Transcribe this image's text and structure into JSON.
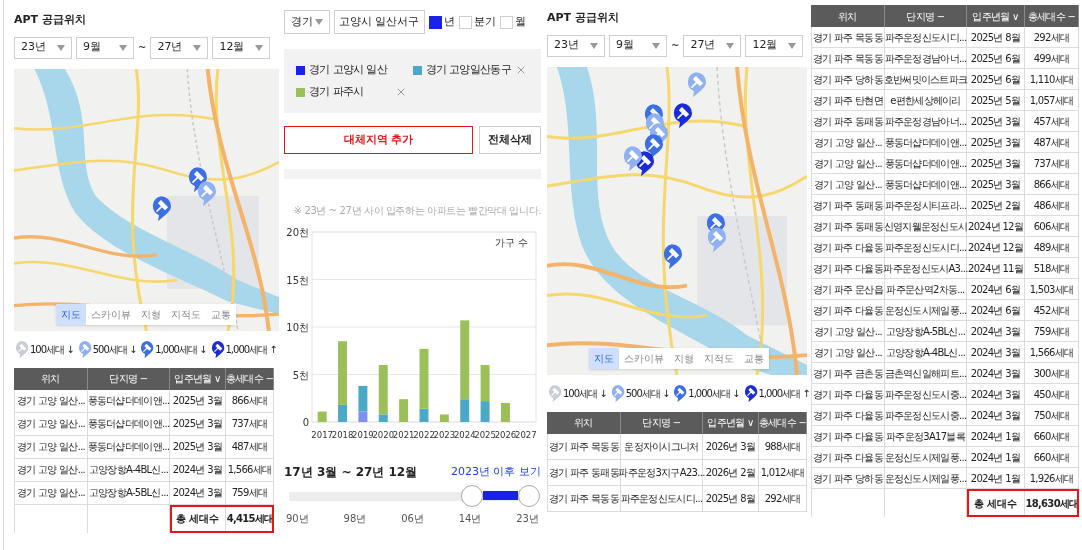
{
  "supply_left": {
    "title": "APT 공급위치",
    "period": {
      "from_year": "23년",
      "from_month": "9월",
      "separator": "~",
      "to_year": "27년",
      "to_month": "12월"
    },
    "map": {
      "kind": "picture",
      "markers": [
        {
          "color": "#3c6fe6"
        },
        {
          "color": "#3c6fe6"
        },
        {
          "color": "#8fb0f2"
        }
      ],
      "map_types": [
        {
          "label": "지도",
          "selected": true
        },
        {
          "label": "스카이뷰",
          "selected": false
        },
        {
          "label": "지형",
          "selected": false
        },
        {
          "label": "지적도",
          "selected": false
        },
        {
          "label": "교통",
          "selected": false
        }
      ]
    },
    "legend": [
      {
        "label": "100세대 ↓",
        "color": "#c8ccd4"
      },
      {
        "label": "500세대 ↓",
        "color": "#8fb0f2"
      },
      {
        "label": "1,000세대 ↓",
        "color": "#3c6fe6"
      },
      {
        "label": "1,000세대 ↑",
        "color": "#1a2bd8"
      }
    ],
    "table": {
      "columns": [
        "위치",
        "단지명 −",
        "입주년월 ∨",
        "총세대수 −"
      ],
      "rows": [
        [
          "경기 고양 일산...",
          "풍동더샵더데이앤...",
          "2025년 3월",
          "866세대"
        ],
        [
          "경기 고양 일산...",
          "풍동더샵더데이앤...",
          "2025년 3월",
          "737세대"
        ],
        [
          "경기 고양 일산...",
          "풍동더샵더데이앤...",
          "2025년 3월",
          "487세대"
        ],
        [
          "경기 고양 일산...",
          "고양장항A-4BL신...",
          "2024년 3월",
          "1,566세대"
        ],
        [
          "경기 고양 일산...",
          "고양장항A-5BL신...",
          "2024년 3월",
          "759세대"
        ]
      ],
      "total": {
        "label": "총 세대수",
        "value": "4,415세대"
      }
    }
  },
  "filter": {
    "province": "경기",
    "district": "고양시 일산서구",
    "periods": [
      {
        "label": "년",
        "checked": true
      },
      {
        "label": "분기",
        "checked": false
      },
      {
        "label": "월",
        "checked": false
      }
    ],
    "regions": [
      {
        "name": "경기 고양시 일산",
        "color": "#1a22e8",
        "removable": false
      },
      {
        "name": "경기 고양일산동구",
        "color": "#4ba9c8",
        "removable": true
      },
      {
        "name": "경기 파주시",
        "color": "#9bc05a",
        "removable": true
      }
    ],
    "buttons": [
      {
        "label": "대체지역 추가",
        "kind": "primary"
      },
      {
        "label": "전체삭제",
        "kind": "plain"
      }
    ],
    "note": "※ 23년 ~ 27년 사이 입주하는 아파트는 빨간막대 입니다.",
    "chart_data": {
      "type": "bar",
      "stacked": true,
      "categories": [
        "2017",
        "2018",
        "2019",
        "2020",
        "2021",
        "2022",
        "2023",
        "2024",
        "2025",
        "2026",
        "2027"
      ],
      "series": [
        {
          "color": "#8090f0",
          "values": [
            null,
            null,
            1.1,
            null,
            null,
            null,
            null,
            null,
            null,
            null,
            null
          ]
        },
        {
          "color": "#4ba9c8",
          "values": [
            null,
            1.8,
            2.7,
            0.8,
            null,
            1.4,
            null,
            2.4,
            2.2,
            null,
            null
          ]
        },
        {
          "color": "#9bc05a",
          "values": [
            1.1,
            6.7,
            null,
            5.2,
            2.4,
            6.3,
            0.8,
            8.3,
            3.8,
            2.0,
            null
          ]
        }
      ],
      "grid": true,
      "ylim": [
        0,
        20
      ],
      "yticks": [
        {
          "value": 0,
          "label": "0"
        },
        {
          "value": 5,
          "label": "5천"
        },
        {
          "value": 10,
          "label": "10천"
        },
        {
          "value": 15,
          "label": "15천"
        },
        {
          "value": 20,
          "label": "20천"
        }
      ],
      "annotations": [
        "가구 수"
      ]
    },
    "range_label": "17년 3월 ~ 27년 12월",
    "range_link": "2023년 이후 보기",
    "range": {
      "thumbs": [
        {
          "level": 0.74
        },
        {
          "level": 0.97
        }
      ],
      "ticks": [
        "90년",
        "98년",
        "06년",
        "14년",
        "23년"
      ]
    }
  },
  "supply_right": {
    "title": "APT 공급위치",
    "period": {
      "from_year": "23년",
      "from_month": "9월",
      "separator": "~",
      "to_year": "27년",
      "to_month": "12월"
    },
    "map": {
      "kind": "picture",
      "markers": [
        {
          "color": "#8fb0f2"
        },
        {
          "color": "#1a2bd8"
        },
        {
          "color": "#3c6fe6"
        },
        {
          "color": "#8fb0f2"
        },
        {
          "color": "#8fb0f2"
        },
        {
          "color": "#3c6fe6"
        },
        {
          "color": "#1a2bd8"
        },
        {
          "color": "#8fb0f2"
        },
        {
          "color": "#3c6fe6"
        },
        {
          "color": "#8fb0f2"
        },
        {
          "color": "#3c6fe6"
        }
      ],
      "map_types": [
        {
          "label": "지도",
          "selected": true
        },
        {
          "label": "스카이뷰",
          "selected": false
        },
        {
          "label": "지형",
          "selected": false
        },
        {
          "label": "지적도",
          "selected": false
        },
        {
          "label": "교통",
          "selected": false
        }
      ]
    },
    "legend": [
      {
        "label": "100세대 ↓",
        "color": "#c8ccd4"
      },
      {
        "label": "500세대 ↓",
        "color": "#8fb0f2"
      },
      {
        "label": "1,000세대 ↓",
        "color": "#3c6fe6"
      },
      {
        "label": "1,000세대 ↑",
        "color": "#1a2bd8"
      }
    ],
    "table": {
      "columns": [
        "위치",
        "단지명 −",
        "입주년월 ∨",
        "총세대수 −"
      ],
      "rows": [
        [
          "경기 파주 목동동",
          "운정자이시그니처",
          "2026년 3월",
          "988세대"
        ],
        [
          "경기 파주 동패동",
          "파주운정3지구A23...",
          "2026년 2월",
          "1,012세대"
        ],
        [
          "경기 파주 목동동",
          "파주운정신도시디...",
          "2025년 8월",
          "292세대"
        ]
      ]
    }
  },
  "list": {
    "columns": [
      "위치",
      "단지명 −",
      "입주년월 ∨",
      "총세대수 −"
    ],
    "rows": [
      [
        "경기 파주 목동동",
        "파주운정신도시디...",
        "2025년 8월",
        "292세대"
      ],
      [
        "경기 파주 목동동",
        "파주운정경남아너...",
        "2025년 6월",
        "499세대"
      ],
      [
        "경기 파주 당하동",
        "호반써밋이스트파크",
        "2025년 6월",
        "1,110세대"
      ],
      [
        "경기 파주 탄현면",
        "e편한세상헤이리",
        "2025년 5월",
        "1,057세대"
      ],
      [
        "경기 파주 동패동",
        "파주운정경남아너...",
        "2025년 3월",
        "457세대"
      ],
      [
        "경기 고양 일산...",
        "풍동더샵더데이앤...",
        "2025년 3월",
        "487세대"
      ],
      [
        "경기 고양 일산...",
        "풍동더샵더데이앤...",
        "2025년 3월",
        "737세대"
      ],
      [
        "경기 고양 일산...",
        "풍동더샵더데이앤...",
        "2025년 3월",
        "866세대"
      ],
      [
        "경기 파주 동패동",
        "파주운정시티프라...",
        "2025년 2월",
        "486세대"
      ],
      [
        "경기 파주 동패동",
        "신영지웰운정신도시",
        "2024년 12월",
        "606세대"
      ],
      [
        "경기 파주 다율동",
        "파주운정신도시디...",
        "2024년 12월",
        "489세대"
      ],
      [
        "경기 파주 다율동",
        "파주운정신도시A3...",
        "2024년 11월",
        "518세대"
      ],
      [
        "경기 파주 문산읍",
        "파주문산역2차동...",
        "2024년 6월",
        "1,503세대"
      ],
      [
        "경기 파주 다율동",
        "운정신도시제일풍...",
        "2024년 6월",
        "452세대"
      ],
      [
        "경기 고양 일산...",
        "고양장항A-5BL신...",
        "2024년 3월",
        "759세대"
      ],
      [
        "경기 고양 일산...",
        "고양장항A-4BL신...",
        "2024년 3월",
        "1,566세대"
      ],
      [
        "경기 파주 금촌동",
        "금촌역신일해피트...",
        "2024년 3월",
        "300세대"
      ],
      [
        "경기 파주 다율동",
        "파주운정신도시중...",
        "2024년 3월",
        "450세대"
      ],
      [
        "경기 파주 다율동",
        "파주운정신도시중...",
        "2024년 3월",
        "750세대"
      ],
      [
        "경기 파주 다율동",
        "파주운정3A17블록",
        "2024년 1월",
        "660세대"
      ],
      [
        "경기 파주 다율동",
        "운정신도시제일풍...",
        "2024년 1월",
        "660세대"
      ],
      [
        "경기 파주 당하동",
        "운정신도시제일풍...",
        "2024년 1월",
        "1,926세대"
      ]
    ],
    "total": {
      "label": "총 세대수",
      "value": "18,630세대"
    }
  }
}
